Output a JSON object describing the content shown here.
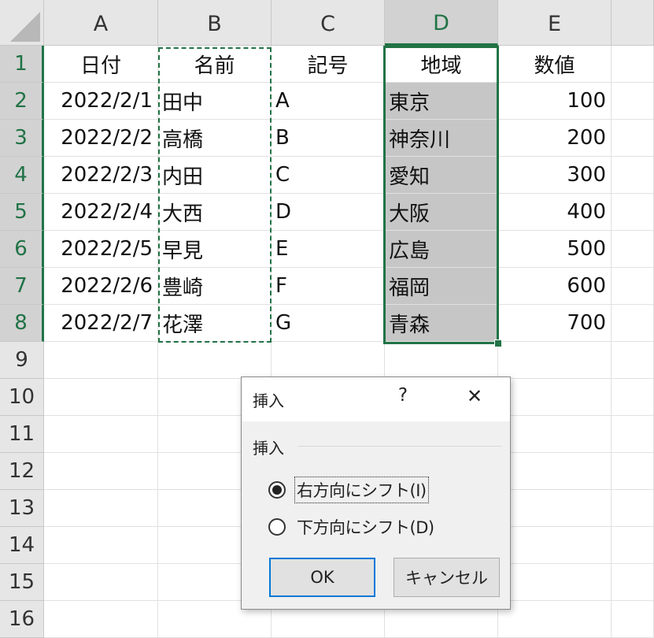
{
  "columns": [
    "A",
    "B",
    "C",
    "D",
    "E"
  ],
  "rows": [
    "1",
    "2",
    "3",
    "4",
    "5",
    "6",
    "7",
    "8",
    "9",
    "10",
    "11",
    "12",
    "13",
    "14",
    "15",
    "16"
  ],
  "headers": {
    "a": "日付",
    "b": "名前",
    "c": "記号",
    "d": "地域",
    "e": "数値"
  },
  "data": [
    {
      "a": "2022/2/1",
      "b": "田中",
      "c": "A",
      "d": "東京",
      "e": "100"
    },
    {
      "a": "2022/2/2",
      "b": "高橋",
      "c": "B",
      "d": "神奈川",
      "e": "200"
    },
    {
      "a": "2022/2/3",
      "b": "内田",
      "c": "C",
      "d": "愛知",
      "e": "300"
    },
    {
      "a": "2022/2/4",
      "b": "大西",
      "c": "D",
      "d": "大阪",
      "e": "400"
    },
    {
      "a": "2022/2/5",
      "b": "早見",
      "c": "E",
      "d": "広島",
      "e": "500"
    },
    {
      "a": "2022/2/6",
      "b": "豊崎",
      "c": "F",
      "d": "福岡",
      "e": "600"
    },
    {
      "a": "2022/2/7",
      "b": "花澤",
      "c": "G",
      "d": "青森",
      "e": "700"
    }
  ],
  "dialog": {
    "title": "挿入",
    "help": "?",
    "close": "✕",
    "group_label": "挿入",
    "option_right": "右方向にシフト(I)",
    "option_down": "下方向にシフト(D)",
    "ok": "OK",
    "cancel": "キャンセル"
  },
  "colors": {
    "accent": "#217346",
    "selection_fill": "#c6c6c6",
    "focus_button": "#0078d7"
  }
}
